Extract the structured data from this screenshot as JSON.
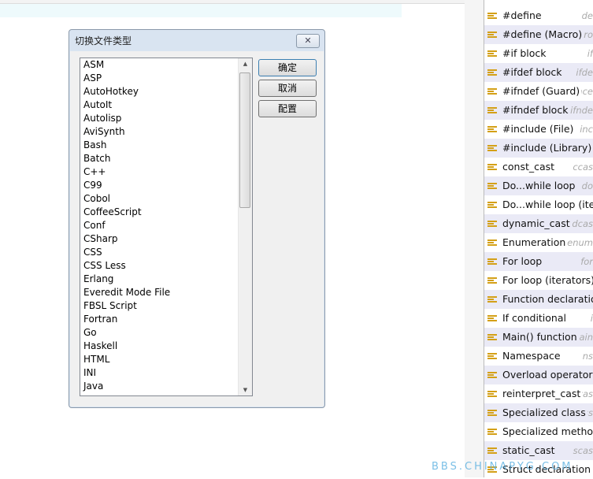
{
  "dialog": {
    "title": "切换文件类型",
    "close": "✕",
    "items": [
      "ASM",
      "ASP",
      "AutoHotkey",
      "AutoIt",
      "Autolisp",
      "AviSynth",
      "Bash",
      "Batch",
      "C++",
      "C99",
      "Cobol",
      "CoffeeScript",
      "Conf",
      "CSharp",
      "CSS",
      "CSS Less",
      "Erlang",
      "Everedit Mode File",
      "FBSL Script",
      "Fortran",
      "Go",
      "Haskell",
      "HTML",
      "INI",
      "Java"
    ],
    "ok": "确定",
    "cancel": "取消",
    "config": "配置"
  },
  "snippets": [
    {
      "label": "#define",
      "short": "de"
    },
    {
      "label": "#define (Macro)",
      "short": "acro"
    },
    {
      "label": "#if block",
      "short": "if"
    },
    {
      "label": "#ifdef block",
      "short": "ifde"
    },
    {
      "label": "#ifndef (Guard)",
      "short": "once"
    },
    {
      "label": "#ifndef block",
      "short": "ifnde"
    },
    {
      "label": "#include (File)",
      "short": "inc"
    },
    {
      "label": "#include (Library)",
      "short": "inc"
    },
    {
      "label": "const_cast",
      "short": "ccas"
    },
    {
      "label": "Do...while loop",
      "short": "do"
    },
    {
      "label": "Do...while loop (itera",
      "short": ""
    },
    {
      "label": "dynamic_cast",
      "short": "dcas"
    },
    {
      "label": "Enumeration",
      "short": "enum"
    },
    {
      "label": "For loop",
      "short": "for"
    },
    {
      "label": "For loop (iterators)",
      "short": ""
    },
    {
      "label": "Function declaration",
      "short": ""
    },
    {
      "label": "If conditional",
      "short": "i"
    },
    {
      "label": "Main() function",
      "short": "main"
    },
    {
      "label": "Namespace",
      "short": "ns"
    },
    {
      "label": "Overload operator",
      "short": ""
    },
    {
      "label": "reinterpret_cast",
      "short": "rcas"
    },
    {
      "label": "Specialized class",
      "short": "ass"
    },
    {
      "label": "Specialized method",
      "short": ""
    },
    {
      "label": "static_cast",
      "short": "scas"
    },
    {
      "label": "Struct declaration",
      "short": ""
    }
  ],
  "watermark": "BBS.CHINAPYG.COM",
  "colors": {
    "snippet_icon": "#d4a017",
    "row_alt": "#eaeaf6"
  }
}
